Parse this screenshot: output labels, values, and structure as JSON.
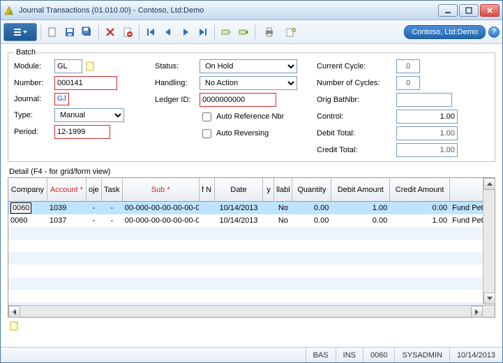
{
  "window": {
    "title": "Journal Transactions (01.010.00) - Contoso, Ltd:Demo"
  },
  "pill": "Contoso, Ltd:Demo",
  "batch": {
    "legend": "Batch",
    "labels": {
      "module": "Module:",
      "number": "Number:",
      "journal": "Journal:",
      "type": "Type:",
      "period": "Period:",
      "status": "Status:",
      "handling": "Handling:",
      "ledger": "Ledger ID:",
      "autoRef": "Auto Reference Nbr",
      "autoRev": "Auto Reversing",
      "curCycle": "Current Cycle:",
      "numCycles": "Number of Cycles:",
      "origBat": "Orig BatNbr:",
      "control": "Control:",
      "debitTot": "Debit Total:",
      "creditTot": "Credit Total:"
    },
    "values": {
      "module": "GL",
      "number": "000141",
      "journal": "GJ",
      "type": "Manual",
      "period": "12-1999",
      "status": "On Hold",
      "handling": "No Action",
      "ledger": "0000000000",
      "autoRef": false,
      "autoRev": false,
      "curCycle": "0",
      "numCycles": "0",
      "origBat": "",
      "control": "1.00",
      "debitTot": "1.00",
      "creditTot": "1.00"
    }
  },
  "detail": {
    "label": "Detail (F4 - for grid/form view)",
    "headers": {
      "company": "Company",
      "account": "Account *",
      "oje": "oje",
      "task": "Task",
      "sub": "Sub *",
      "fn": "f N",
      "date": "Date",
      "y": "y",
      "llabl": "llabl",
      "qty": "Quantity",
      "debit": "Debit Amount",
      "credit": "Credit Amount",
      "desc": ""
    },
    "rows": [
      {
        "company": "0060",
        "account": "1039",
        "oje": "-",
        "task": "-",
        "sub": "00-000-00-00-00-00-0",
        "fn": "",
        "date": "10/14/2013",
        "y": "",
        "llabl": "No",
        "qty": "0.00",
        "debit": "1.00",
        "credit": "0.00",
        "desc": "Fund Petty",
        "selected": true
      },
      {
        "company": "0060",
        "account": "1037",
        "oje": "-",
        "task": "-",
        "sub": "00-000-00-00-00-00-0",
        "fn": "",
        "date": "10/14/2013",
        "y": "",
        "llabl": "No",
        "qty": "0.00",
        "debit": "0.00",
        "credit": "1.00",
        "desc": "Fund Petty",
        "selected": false
      }
    ]
  },
  "status": {
    "bas": "BAS",
    "ins": "INS",
    "code": "0060",
    "user": "SYSADMIN",
    "date": "10/14/2013"
  },
  "icons": {
    "new": "new",
    "save": "save",
    "saveall": "saveall",
    "delete": "delete",
    "cancel": "cancel",
    "first": "first",
    "prev": "prev",
    "next": "next",
    "last": "last",
    "tool1": "tool1",
    "tool2": "tool2",
    "print": "print",
    "tool3": "tool3",
    "note": "note"
  }
}
